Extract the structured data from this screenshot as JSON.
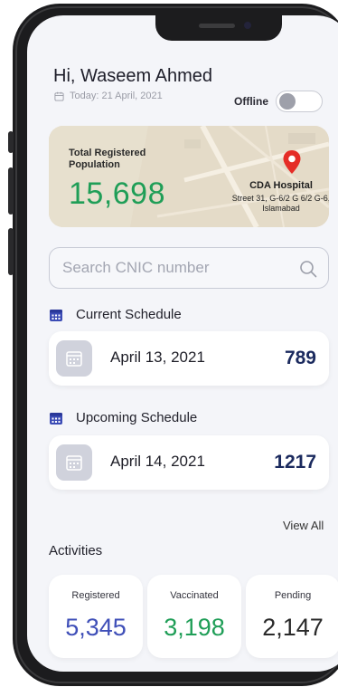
{
  "header": {
    "greeting": "Hi, Waseem Ahmed",
    "date_text": "Today: 21 April, 2021",
    "offline_label": "Offline",
    "offline_enabled": false
  },
  "summary": {
    "label": "Total Registered Population",
    "value": "15,698",
    "hospital_name": "CDA Hospital",
    "hospital_address": "Street 31, G-6/2 G 6/2 G-6, Islamabad"
  },
  "search": {
    "placeholder": "Search CNIC number",
    "value": ""
  },
  "current_schedule": {
    "title": "Current Schedule",
    "date": "April 13, 2021",
    "count": "789"
  },
  "upcoming_schedule": {
    "title": "Upcoming Schedule",
    "date": "April 14, 2021",
    "count": "1217"
  },
  "view_all_label": "View All",
  "activities": {
    "title": "Activities",
    "items": [
      {
        "label": "Registered",
        "value": "5,345",
        "color": "#3f4fb8"
      },
      {
        "label": "Vaccinated",
        "value": "3,198",
        "color": "#1f9e57"
      },
      {
        "label": "Pending",
        "value": "2,147",
        "color": "#2a2a2a"
      }
    ]
  },
  "colors": {
    "accent_green": "#1f9e57",
    "accent_navy": "#1b2a5e",
    "calendar_blue": "#3b4bb5",
    "pin_red": "#e52d27",
    "background": "#f4f5f9"
  },
  "icons": {
    "calendar": "calendar-icon",
    "search": "search-icon",
    "pin": "map-pin-icon"
  }
}
